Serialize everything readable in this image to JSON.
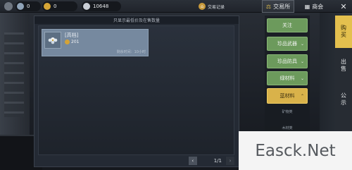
{
  "top_bar": {
    "currencies": [
      {
        "value": "0",
        "icon": "diamond-icon"
      },
      {
        "value": "0",
        "icon": "gold-coin-icon"
      },
      {
        "value": "10648",
        "icon": "silver-coin-icon"
      }
    ],
    "trade_record": "交易记录",
    "tabs": [
      {
        "label": "交易所",
        "icon": "exchange-icon",
        "active": true
      },
      {
        "label": "商会",
        "icon": "shop-icon",
        "active": false
      }
    ]
  },
  "panel": {
    "header": "只显示最低价及在售数量",
    "items": [
      {
        "name": "[高档]",
        "price": "201",
        "time": "剩余时间：10小时"
      }
    ],
    "pager": {
      "text": "1/1",
      "prev": "‹",
      "next": "›"
    }
  },
  "categories": [
    {
      "label": "关注",
      "style": "green",
      "chevron": ""
    },
    {
      "label": "珍品武器",
      "style": "green",
      "chevron": "⌄"
    },
    {
      "label": "珍品防具",
      "style": "green",
      "chevron": "⌄"
    },
    {
      "label": "绿材料",
      "style": "green",
      "chevron": "⌄"
    },
    {
      "label": "蓝材料",
      "style": "gold",
      "chevron": "⌃"
    }
  ],
  "subcategories": [
    "矿物类",
    "木材类"
  ],
  "side_tabs": [
    {
      "label": "购买",
      "active": true
    },
    {
      "label": "出售",
      "active": false
    },
    {
      "label": "公示",
      "active": false
    }
  ],
  "watermark": "Easck.Net",
  "colors": {
    "accent_gold": "#e4c04e",
    "category_green": "#6c9a5c",
    "item_card": "#76899f"
  }
}
